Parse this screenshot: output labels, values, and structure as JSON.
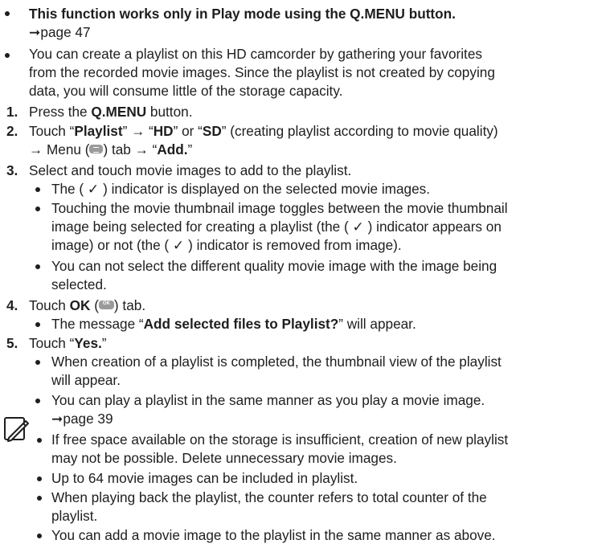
{
  "top": {
    "bold_line": "This function works only in Play mode using the Q.MENU button.",
    "page_ref": "page 47",
    "intro": [
      "You can create a playlist on this HD camcorder by gathering your favorites",
      "from the recorded movie images. Since the playlist is not created by copying",
      "data, you will consume little of the storage capacity."
    ]
  },
  "steps": {
    "s1": {
      "num": "1.",
      "pre": "Press the ",
      "bold": "Q.MENU",
      "post": " button."
    },
    "s2": {
      "num": "2.",
      "l1": [
        {
          "t": "Touch “",
          "b": false
        },
        {
          "t": "Playlist",
          "b": true
        },
        {
          "t": "” → “",
          "b": false
        },
        {
          "t": "HD",
          "b": true
        },
        {
          "t": "” or “",
          "b": false
        },
        {
          "t": "SD",
          "b": true
        },
        {
          "t": "” (creating playlist according to movie quality)",
          "b": false
        }
      ],
      "l2_pre": "→ Menu (",
      "l2_mid": ") tab → “",
      "l2_bold": "Add.",
      "l2_post": "”"
    },
    "s3": {
      "num": "3.",
      "text": "Select and touch movie images to add to the playlist.",
      "bullets": [
        [
          "The ( ✓ ) indicator is displayed on the selected movie images."
        ],
        [
          "Touching the movie thumbnail image toggles between the movie thumbnail",
          "image being selected for creating a playlist (the ( ✓ ) indicator appears on",
          "image) or not (the ( ✓ ) indicator is removed from image)."
        ],
        [
          "You can not select the different quality movie image with the image being",
          "selected."
        ]
      ]
    },
    "s4": {
      "num": "4.",
      "pre": "Touch ",
      "bold": "OK",
      "mid": " (",
      "icon_text": "OK",
      "post": ") tab.",
      "bullet_pre": "The message “",
      "bullet_bold": "Add selected files to Playlist?",
      "bullet_post": "” will appear."
    },
    "s5": {
      "num": "5.",
      "pre": "Touch “",
      "bold": "Yes.",
      "post": "”",
      "bullets": [
        [
          "When creation of a playlist is completed, the thumbnail view of the playlist",
          "will appear."
        ],
        [
          "You can play a playlist in the same manner as you play a movie image."
        ]
      ],
      "page_ref": "page 39"
    }
  },
  "notes": [
    [
      "If free space available on the storage is insufficient, creation of new playlist",
      "may not be possible. Delete unnecessary movie images."
    ],
    [
      "Up to 64 movie images can be included in playlist."
    ],
    [
      "When playing back the playlist, the counter refers to total counter of the",
      "playlist."
    ],
    [
      "You can add a movie image to the playlist in the same manner as above."
    ]
  ]
}
